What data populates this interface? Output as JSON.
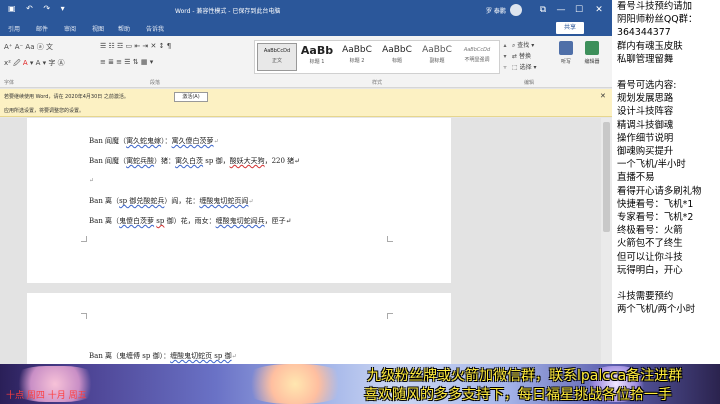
{
  "window": {
    "title": "Word - 兼容性模式 - 已保存到此台电脑",
    "user": "罗 泰鹏",
    "buttons": [
      "⧉",
      "—",
      "☐",
      "✕"
    ]
  },
  "tabs": [
    "引用",
    "邮件",
    "审阅",
    "视图",
    "帮助",
    "告诉我"
  ],
  "share_label": "共享",
  "ribbon": {
    "font_group_label": "字体",
    "paragraph_group_label": "段落",
    "styles_group_label": "样式",
    "editing_group_label": "编辑",
    "styles": [
      {
        "preview": "AaBbCcDd",
        "name": "正文"
      },
      {
        "preview": "AaBb",
        "name": "标题 1"
      },
      {
        "preview": "AaBbC",
        "name": "标题 2"
      },
      {
        "preview": "AaBbC",
        "name": "标题"
      },
      {
        "preview": "AaBbC",
        "name": "副标题"
      },
      {
        "preview": "AaBbCcDd",
        "name": "不明显强调"
      }
    ],
    "editing": [
      "查找",
      "替换",
      "选择"
    ],
    "buttons": [
      "听写",
      "编辑器"
    ]
  },
  "notice": {
    "text1": "若要继续使用 Word，请在 2020年4月30日 之前激活。",
    "button": "激活(A)",
    "text2": "应用所选设置，将要调整您的设置。"
  },
  "document": {
    "lines": [
      [
        {
          "t": "Ban 阎魔（",
          "u": ""
        },
        {
          "t": "寓久蛇鬼嫁",
          "u": "blue"
        },
        {
          "t": "）：",
          "u": ""
        },
        {
          "t": "寓久傻白茨萝",
          "u": "blue"
        },
        {
          "t": "↵",
          "u": "ret"
        }
      ],
      [
        {
          "t": "Ban 阎魔（",
          "u": ""
        },
        {
          "t": "寓蛇兵酸",
          "u": "blue"
        },
        {
          "t": "）猪：",
          "u": ""
        },
        {
          "t": "寓久白茨",
          "u": "blue"
        },
        {
          "t": " sp 御，",
          "u": ""
        },
        {
          "t": "酸妖大天狗",
          "u": "red"
        },
        {
          "t": "，220 猪↵",
          "u": ""
        }
      ],
      [
        {
          "t": "↵",
          "u": "ret"
        }
      ],
      [
        {
          "t": "Ban 离（",
          "u": ""
        },
        {
          "t": "sp 御兑酸蛇兵",
          "u": "blue"
        },
        {
          "t": "）阎，花：",
          "u": ""
        },
        {
          "t": "缠酸鬼切蛇页阎",
          "u": "blue"
        },
        {
          "t": "↵",
          "u": "ret"
        }
      ],
      [
        {
          "t": "Ban 离（",
          "u": ""
        },
        {
          "t": "鬼傻白茨萝",
          "u": "blue"
        },
        {
          "t": " ",
          "u": ""
        },
        {
          "t": "sp",
          "u": "red"
        },
        {
          "t": " 御）花，雨女：",
          "u": ""
        },
        {
          "t": "缠酸鬼切蛇阎兵",
          "u": "blue"
        },
        {
          "t": "，匣子↵",
          "u": ""
        }
      ],
      [
        {
          "t": "Ban 离（鬼缠傅 sp 御）：",
          "u": ""
        },
        {
          "t": "缠酸鬼切蛇页 sp 御",
          "u": "blue"
        },
        {
          "t": "↵",
          "u": "ret"
        }
      ]
    ]
  },
  "right_panel": [
    "看号斗技预约请加",
    "阴阳师粉丝QQ群：",
    "364344377",
    "群内有魂玉皮肤",
    "私聊管理留舞",
    "",
    "看号可选内容:",
    "规划发展思路",
    "设计斗技阵容",
    "精调斗技御魂",
    "操作细节说明",
    "御魂购买提升",
    "一个飞机/半小时",
    "直播不易",
    "看得开心请多刷礼物",
    "快捷看号：飞机*1",
    "专家看号：飞机*2",
    "终极看号：火箭",
    "火箭包不了终生",
    "但可以让你斗技",
    "玩得明白，开心",
    "",
    "斗技需要预约",
    "两个飞机/两个小时"
  ],
  "bottom": {
    "line1": "九级粉丝牌或火箭加微信群，联系lpalcca备注进群",
    "line2": "喜欢随风的多多支持下，每日福星挑战各位拾一手",
    "left_text": "十点 周四   十月 周五"
  }
}
